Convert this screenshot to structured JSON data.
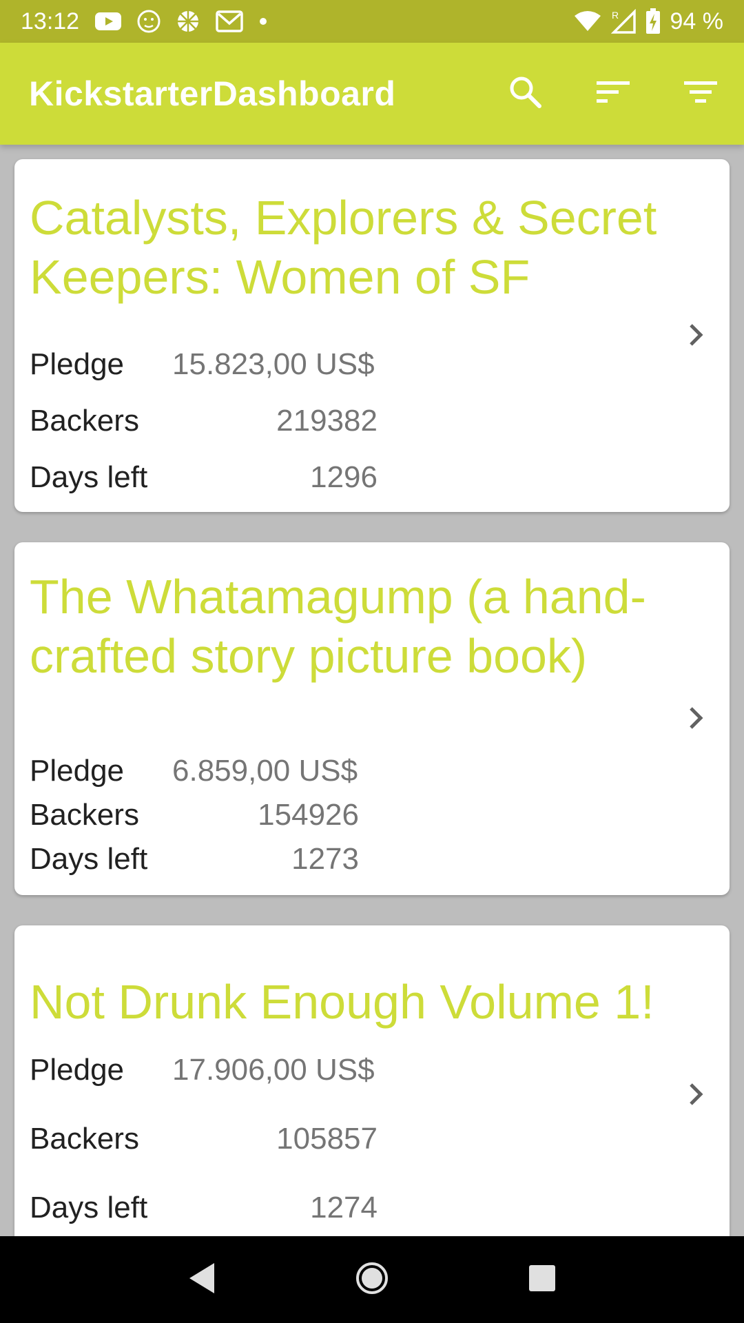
{
  "status_bar": {
    "time": "13:12",
    "battery": "94 %",
    "icons": [
      "youtube-icon",
      "lion-app-icon",
      "ball-icon",
      "gmail-icon",
      "dot-icon",
      "wifi-icon",
      "signal-roaming-icon",
      "battery-charging-icon"
    ]
  },
  "app_bar": {
    "title": "KickstarterDashboard",
    "actions": [
      "search-icon",
      "sort-icon",
      "filter-icon"
    ],
    "color": "#cddc39"
  },
  "projects": [
    {
      "title": "Catalysts, Explorers & Secret Keepers: Women of SF",
      "pledge_label": "Pledge",
      "pledge": "15.823,00 US$",
      "backers_label": "Backers",
      "backers": "219382",
      "days_label": "Days left",
      "days": "1296"
    },
    {
      "title": "The Whatamagump (a hand-crafted story picture book)",
      "pledge_label": "Pledge",
      "pledge": "6.859,00 US$",
      "backers_label": "Backers",
      "backers": "154926",
      "days_label": "Days left",
      "days": "1273"
    },
    {
      "title": "Not Drunk Enough Volume 1!",
      "pledge_label": "Pledge",
      "pledge": "17.906,00 US$",
      "backers_label": "Backers",
      "backers": "105857",
      "days_label": "Days left",
      "days": "1274"
    }
  ],
  "nav_bar": {
    "buttons": [
      "back-icon",
      "home-icon",
      "recents-icon"
    ]
  }
}
